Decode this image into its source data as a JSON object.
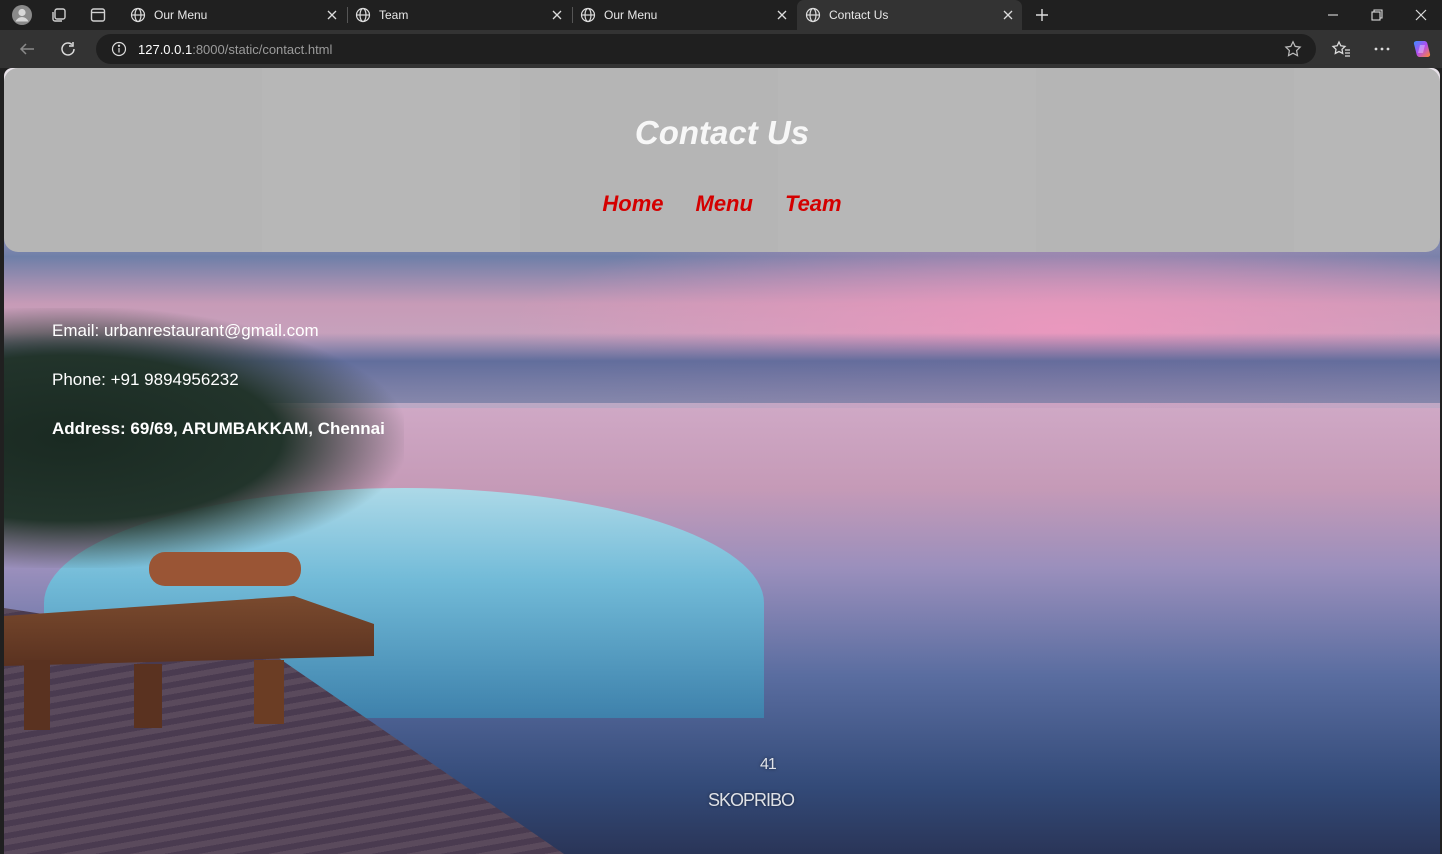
{
  "browser": {
    "tabs": [
      {
        "label": "Our Menu",
        "active": false
      },
      {
        "label": "Team",
        "active": false
      },
      {
        "label": "Our Menu",
        "active": false
      },
      {
        "label": "Contact Us",
        "active": true
      }
    ],
    "url_host": "127.0.0.1",
    "url_rest": ":8000/static/contact.html",
    "icons": {
      "profile": "profile-avatar-icon",
      "workspaces": "workspaces-icon",
      "tab_actions": "tab-actions-icon",
      "new_tab": "plus-icon",
      "back": "back-arrow-icon",
      "refresh": "refresh-icon",
      "info": "info-icon",
      "favorite": "star-icon",
      "favorites": "favorites-icon",
      "more": "more-icon",
      "copilot": "copilot-icon"
    }
  },
  "page": {
    "title": "Contact Us",
    "nav": [
      "Home",
      "Menu",
      "Team"
    ],
    "contact": {
      "email": "Email: urbanrestaurant@gmail.com",
      "phone": "Phone: +91 9894956232",
      "address": "Address: 69/69, ARUMBAKKAM, Chennai"
    },
    "watermark": {
      "line1": "41",
      "line2": "SKOPRIBO"
    },
    "colors": {
      "header_bg": "#b5b5b5",
      "title": "#f7f7f7",
      "nav_link": "#d40000",
      "contact_text": "#ffffff"
    }
  }
}
